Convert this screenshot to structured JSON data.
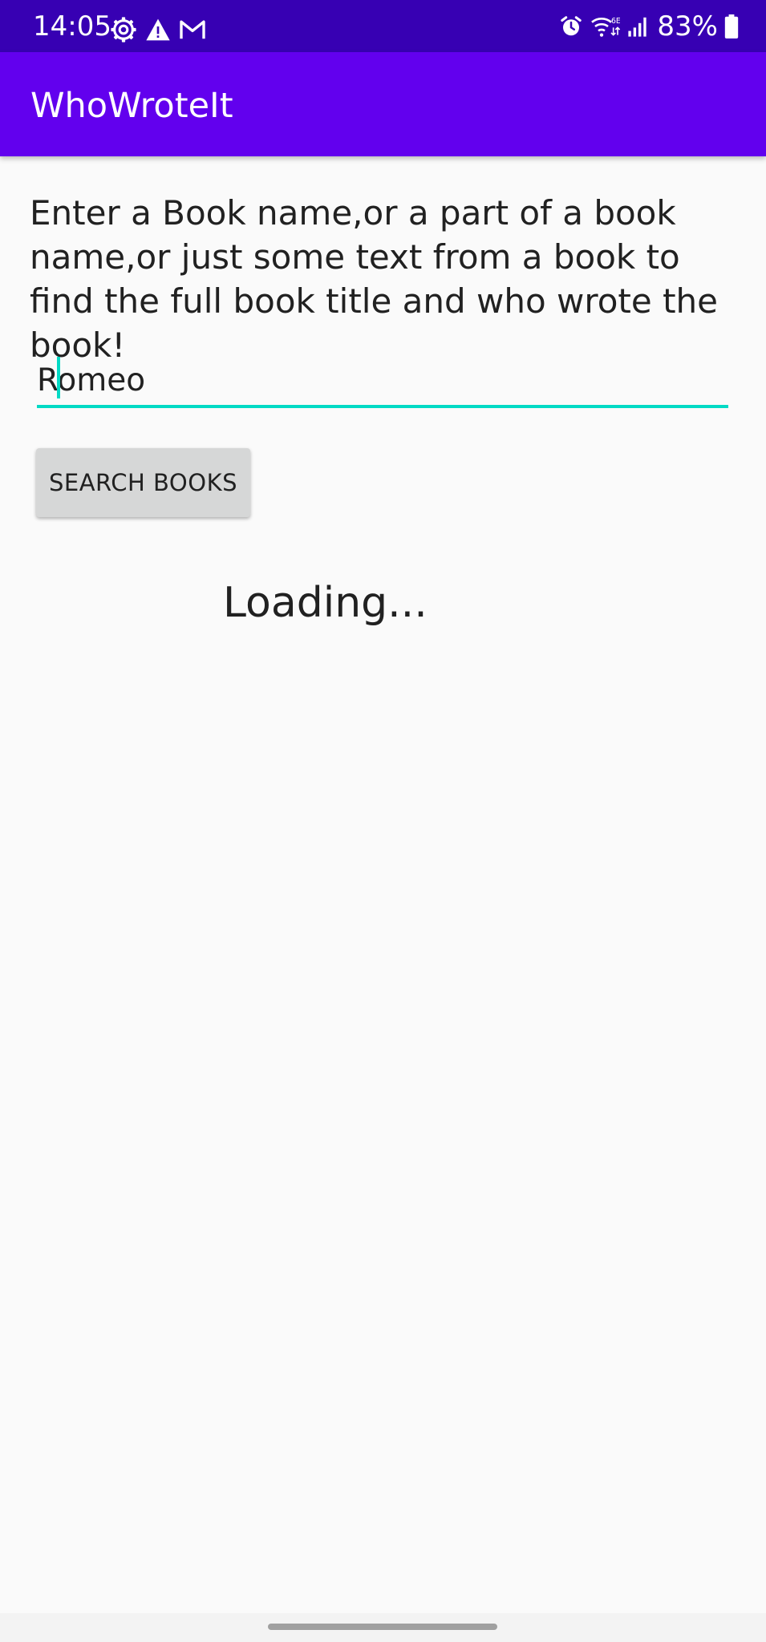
{
  "status_bar": {
    "time": "14:05",
    "battery_percent": "83%",
    "left_icons": [
      "settings-gear-icon",
      "warning-icon",
      "gmail-icon"
    ],
    "right_icons": [
      "alarm-icon",
      "wifi-6e-icon",
      "signal-icon",
      "battery-icon"
    ],
    "background_color": "#3700b3"
  },
  "app_bar": {
    "title": "WhoWroteIt",
    "background_color": "#6200ee"
  },
  "main": {
    "instructions": "Enter a Book name,or a part of a book name,or just some text from a book to find the full book title and who wrote the book!",
    "search_input": {
      "value": "Romeo",
      "accent_color": "#03dac5"
    },
    "search_button_label": "SEARCH BOOKS",
    "status_text": "Loading..."
  }
}
